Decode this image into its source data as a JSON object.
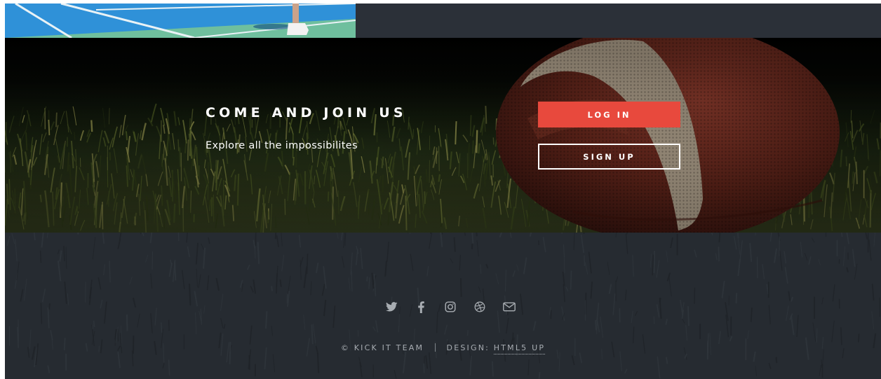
{
  "hero": {
    "title": "COME AND JOIN US",
    "subtitle": "Explore all the impossibilites",
    "login_label": "LOG IN",
    "signup_label": "SIGN UP"
  },
  "footer": {
    "social_icons": [
      "twitter-icon",
      "facebook-icon",
      "instagram-icon",
      "dribbble-icon",
      "email-icon"
    ],
    "copyright_text": "© KICK IT TEAM",
    "design_label": "DESIGN:",
    "design_link": "HTML5 UP"
  },
  "colors": {
    "accent": "#e8493d",
    "dark_bg": "#2b3038",
    "footer_bg": "#262b31",
    "footer_text": "#a8adb2"
  }
}
